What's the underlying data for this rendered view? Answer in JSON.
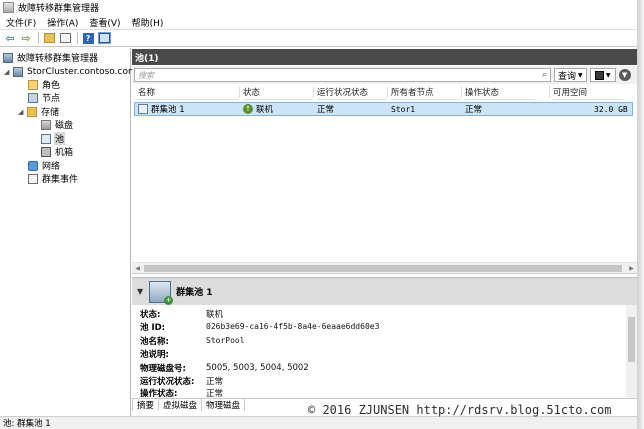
{
  "window": {
    "title": "故障转移群集管理器"
  },
  "menu": [
    "文件(F)",
    "操作(A)",
    "查看(V)",
    "帮助(H)"
  ],
  "toolbar": {
    "icons": [
      "back-icon",
      "forward-icon",
      "up-icon",
      "show-hide-tree-icon",
      "help-icon",
      "panel-icon"
    ]
  },
  "tree": {
    "root": "故障转移群集管理器",
    "cluster": "StorCluster.contoso.com",
    "items": [
      "角色",
      "节点",
      "存储",
      "磁盘",
      "池",
      "机箱",
      "网络",
      "群集事件"
    ]
  },
  "pane": {
    "title": "池(1)",
    "search_placeholder": "搜索",
    "query_label": "查询"
  },
  "table": {
    "columns": [
      "名称",
      "状态",
      "运行状况状态",
      "所有者节点",
      "操作状态",
      "可用空间"
    ],
    "rows": [
      {
        "name": "群集池 1",
        "status": "联机",
        "health": "正常",
        "owner": "Stor1",
        "op_status": "正常",
        "free_space": "32.0 GB"
      }
    ]
  },
  "detail": {
    "title": "群集池 1",
    "props": [
      {
        "label": "状态:",
        "value": "联机"
      },
      {
        "label": "池 ID:",
        "value": "026b3e69-ca16-4f5b-8a4e-6eaae6dd60e3"
      },
      {
        "label": "池名称:",
        "value": "StorPool"
      },
      {
        "label": "池说明:",
        "value": ""
      },
      {
        "label": "物理磁盘号:",
        "value": "5005, 5003, 5004, 5002"
      },
      {
        "label": "运行状况状态:",
        "value": "正常"
      },
      {
        "label": "操作状态:",
        "value": "正常"
      }
    ],
    "tabs": [
      "摘要",
      "虚拟磁盘",
      "物理磁盘"
    ]
  },
  "status_bar": "池: 群集池 1",
  "watermark": "© 2016 ZJUNSEN http://rdsrv.blog.51cto.com"
}
